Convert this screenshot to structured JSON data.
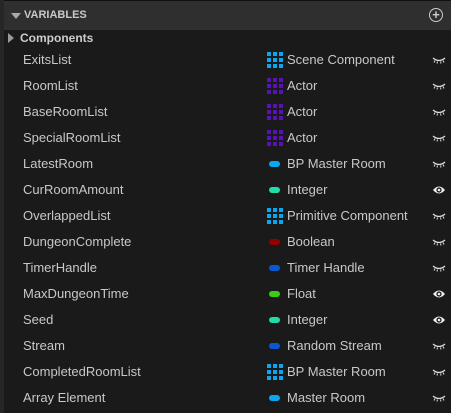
{
  "header": {
    "title": "VARIABLES",
    "add_icon": "plus-circle-icon"
  },
  "category": {
    "label": "Components"
  },
  "colors": {
    "object_ref": "#0aa6f0",
    "actor": "#5a12b8",
    "integer": "#1fdca8",
    "boolean": "#920000",
    "struct": "#0a58d0",
    "float": "#3ccc10"
  },
  "variables": [
    {
      "name": "ExitsList",
      "type": "Scene Component",
      "color": "#0aa6f0",
      "container": "array",
      "visible": false
    },
    {
      "name": "RoomList",
      "type": "Actor",
      "color": "#5a12b8",
      "container": "array",
      "visible": false
    },
    {
      "name": "BaseRoomList",
      "type": "Actor",
      "color": "#5a12b8",
      "container": "array",
      "visible": false
    },
    {
      "name": "SpecialRoomList",
      "type": "Actor",
      "color": "#5a12b8",
      "container": "array",
      "visible": false
    },
    {
      "name": "LatestRoom",
      "type": "BP Master Room",
      "color": "#0aa6f0",
      "container": "single",
      "visible": false
    },
    {
      "name": "CurRoomAmount",
      "type": "Integer",
      "color": "#1fdca8",
      "container": "single",
      "visible": true
    },
    {
      "name": "OverlappedList",
      "type": "Primitive Component",
      "color": "#0aa6f0",
      "container": "array",
      "visible": false
    },
    {
      "name": "DungeonComplete",
      "type": "Boolean",
      "color": "#920000",
      "container": "single",
      "visible": false
    },
    {
      "name": "TimerHandle",
      "type": "Timer Handle",
      "color": "#0a58d0",
      "container": "single",
      "visible": false
    },
    {
      "name": "MaxDungeonTime",
      "type": "Float",
      "color": "#3ccc10",
      "container": "single",
      "visible": true
    },
    {
      "name": "Seed",
      "type": "Integer",
      "color": "#1fdca8",
      "container": "single",
      "visible": true
    },
    {
      "name": "Stream",
      "type": "Random Stream",
      "color": "#0a58d0",
      "container": "single",
      "visible": false
    },
    {
      "name": "CompletedRoomList",
      "type": "BP Master Room",
      "color": "#0aa6f0",
      "container": "array",
      "visible": false
    },
    {
      "name": "Array Element",
      "type": "Master Room",
      "color": "#0aa6f0",
      "container": "single",
      "visible": false
    }
  ]
}
